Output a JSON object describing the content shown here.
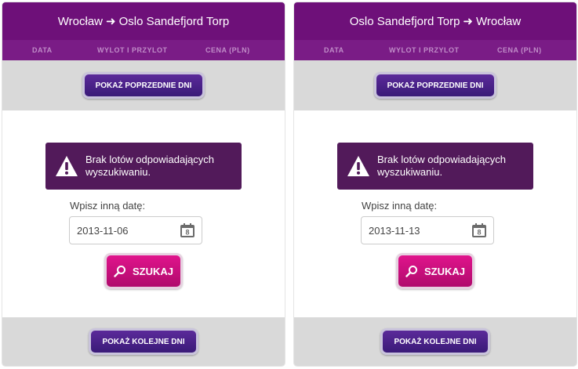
{
  "panels": [
    {
      "route": {
        "from": "Wrocław",
        "arrow": "➜",
        "to": "Oslo Sandefjord Torp"
      },
      "columns": {
        "date": "DATA",
        "times": "WYLOT I PRZYLOT",
        "price": "CENA (PLN)"
      },
      "prev_button": "POKAŻ POPRZEDNIE DNI",
      "alert": "Brak lotów odpowiadających wyszukiwaniu.",
      "date_label": "Wpisz inną datę:",
      "date_value": "2013-11-06",
      "calendar_day": "8",
      "search_button": "SZUKAJ",
      "next_button": "POKAŻ KOLEJNE DNI"
    },
    {
      "route": {
        "from": "Oslo Sandefjord Torp",
        "arrow": "➜",
        "to": "Wrocław"
      },
      "columns": {
        "date": "DATA",
        "times": "WYLOT I PRZYLOT",
        "price": "CENA (PLN)"
      },
      "prev_button": "POKAŻ POPRZEDNIE DNI",
      "alert": "Brak lotów odpowiadających wyszukiwaniu.",
      "date_label": "Wpisz inną datę:",
      "date_value": "2013-11-13",
      "calendar_day": "8",
      "search_button": "SZUKAJ",
      "next_button": "POKAŻ KOLEJNE DNI"
    }
  ],
  "colors": {
    "header": "#6e1079",
    "subheader": "#7a1c86",
    "alert_bg": "#521a5a",
    "button_purple": "#4a2288",
    "button_search": "#d0107f",
    "band_gray": "#d9d9d9"
  },
  "icons": [
    "warning-icon",
    "calendar-icon",
    "search-icon"
  ]
}
